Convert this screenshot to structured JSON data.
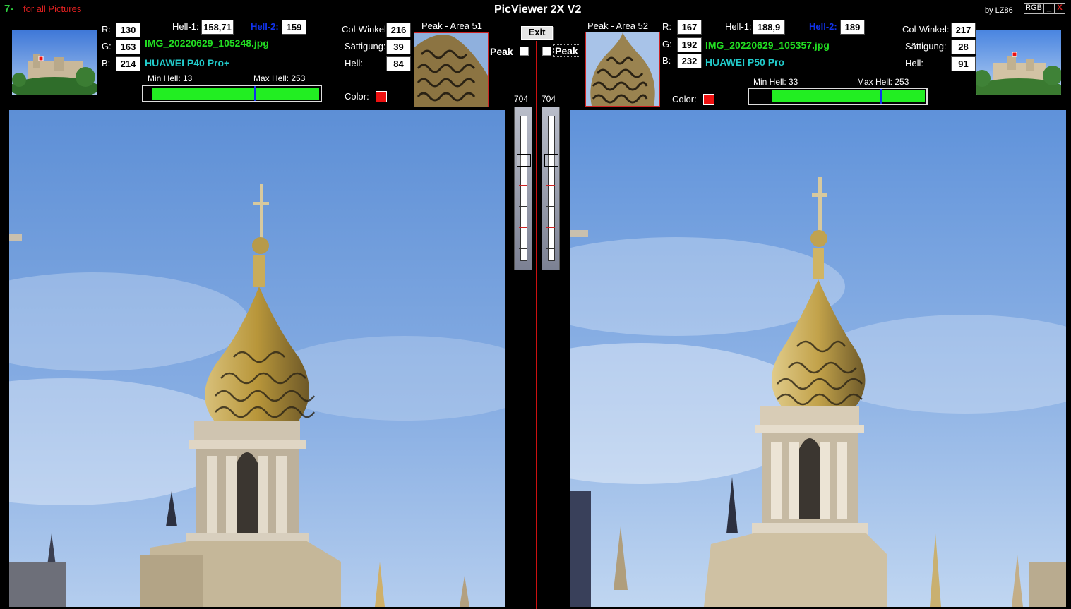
{
  "app": {
    "title": "PicViewer 2X V2",
    "logo_text": "7-",
    "for_all": "for all Pictures",
    "by": "by LZ86",
    "rgb_button": "RGB",
    "minimize": "_",
    "close": "X",
    "exit": "Exit"
  },
  "left": {
    "r_label": "R:",
    "r": "130",
    "g_label": "G:",
    "g": "163",
    "b_label": "B:",
    "b": "214",
    "hell1_label": "Hell-1:",
    "hell1": "158,71",
    "hell2_label": "Hell-2:",
    "hell2": "159",
    "filename": "IMG_20220629_105248.jpg",
    "model": "HUAWEI P40 Pro+",
    "min_hell_label": "Min Hell: 13",
    "max_hell_label": "Max Hell:  253",
    "colwinkel_label": "Col-Winkel",
    "colwinkel": "216",
    "saettigung_label": "Sättigung:",
    "saettigung": "39",
    "hell_label": "Hell:",
    "hell": "84",
    "color_label": "Color:",
    "peak_area": "Peak - Area 51",
    "peak_label": "Peak",
    "slider_value": "704"
  },
  "right": {
    "r_label": "R:",
    "r": "167",
    "g_label": "G:",
    "g": "192",
    "b_label": "B:",
    "b": "232",
    "hell1_label": "Hell-1:",
    "hell1": "188,9",
    "hell2_label": "Hell-2:",
    "hell2": "189",
    "filename": "IMG_20220629_105357.jpg",
    "model": "HUAWEI P50 Pro",
    "min_hell_label": "Min Hell:  33",
    "max_hell_label": "Max Hell:  253",
    "colwinkel_label": "Col-Winkel:",
    "colwinkel": "217",
    "saettigung_label": "Sättigung:",
    "saettigung": "28",
    "hell_label": "Hell:",
    "hell": "91",
    "color_label": "Color:",
    "peak_area": "Peak - Area 52",
    "peak_label": "Peak",
    "slider_value": "704"
  },
  "histogram": {
    "left": {
      "min": 13,
      "max": 253,
      "marker": 159
    },
    "right": {
      "min": 33,
      "max": 253,
      "marker": 189
    }
  },
  "colors": {
    "sky_top": "#5d8fd6",
    "sky_bottom": "#9fbfe8",
    "gold": "#b8963a",
    "stone": "#cfc4b0",
    "swatch": "#ee1111",
    "green": "#22ee22",
    "blue_marker": "#1133ee"
  },
  "icons": {
    "logo": "app-logo-icon",
    "close": "close-icon",
    "minimize": "minimize-icon"
  }
}
